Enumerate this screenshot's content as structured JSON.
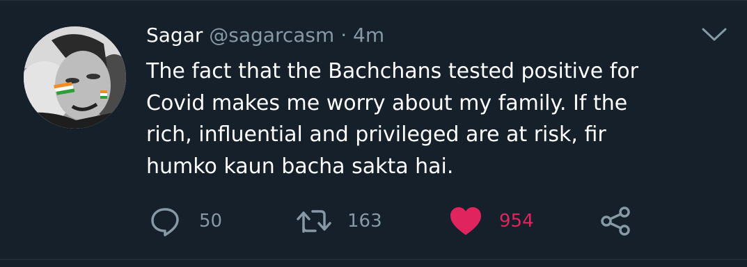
{
  "tweet": {
    "display_name": "Sagar",
    "handle": "@sagarcasm",
    "separator": "·",
    "time": "4m",
    "text_lines": [
      "The fact that the Bachchans tested positive for",
      "Covid makes me worry about my family. If the",
      "rich, influential and privileged are at risk, fir",
      "humko kaun bacha sakta hai."
    ],
    "avatar_icon": "profile-photo",
    "menu_icon": "chevron-down-icon"
  },
  "actions": {
    "reply": {
      "icon": "reply-icon",
      "count": "50"
    },
    "retweet": {
      "icon": "retweet-icon",
      "count": "163"
    },
    "like": {
      "icon": "heart-icon",
      "count": "954",
      "liked": true
    },
    "share": {
      "icon": "share-icon"
    }
  },
  "colors": {
    "background": "#15202b",
    "text_primary": "#ffffff",
    "text_secondary": "#8899a6",
    "like_active": "#e0245e"
  }
}
